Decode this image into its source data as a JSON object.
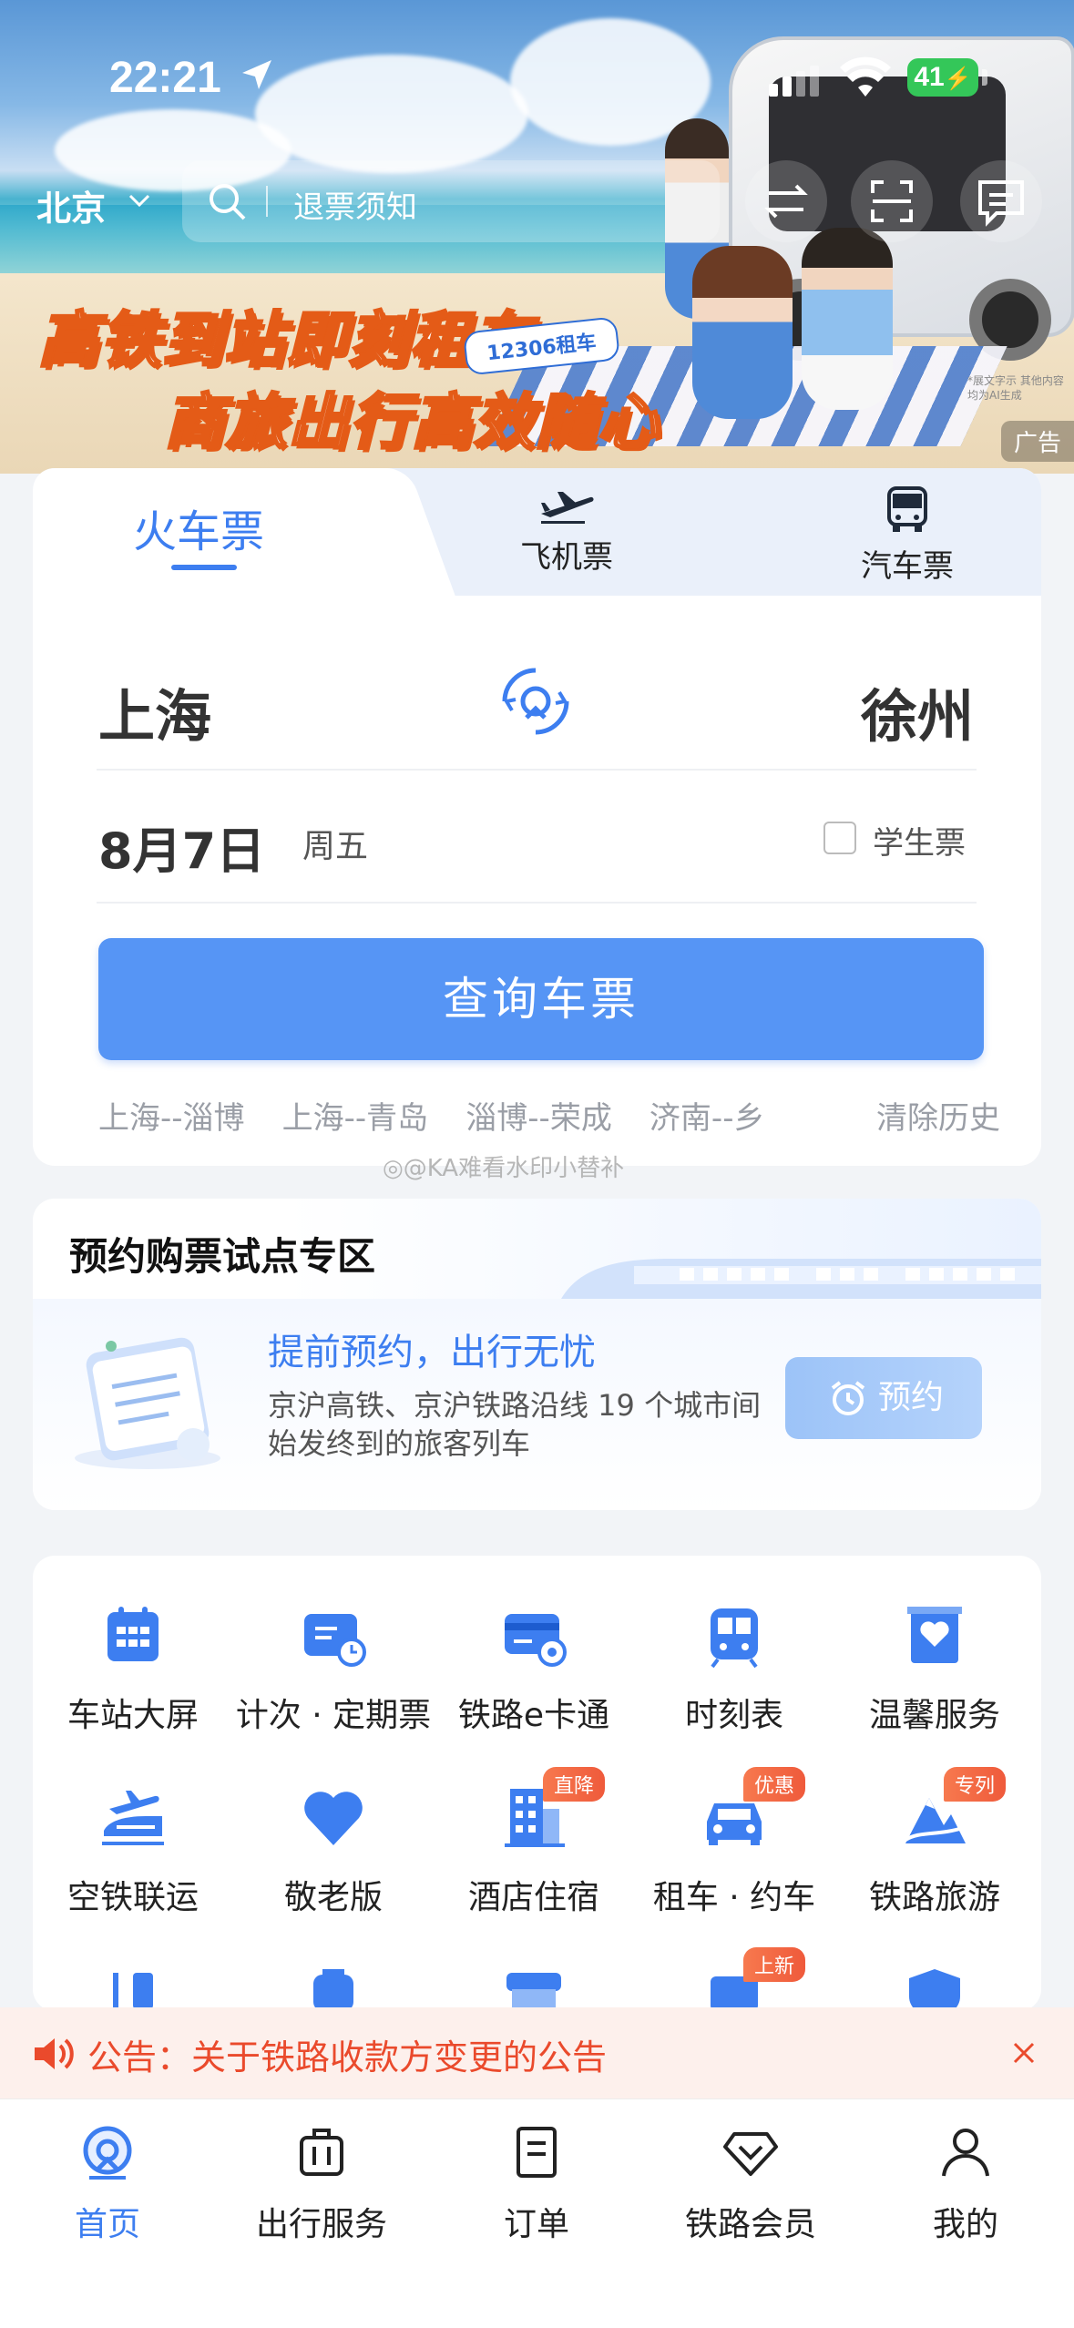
{
  "status_bar": {
    "time": "22:21",
    "battery": "41"
  },
  "hero": {
    "line1": "高铁到站即刻租车",
    "line2": "商旅出行高效随心",
    "tag": "12306租车",
    "note": "*展文字示 其他内容均为AI生成",
    "ad_badge": "广告"
  },
  "top_bar": {
    "city": "北京",
    "search_placeholder": "退票须知"
  },
  "booking": {
    "tabs": [
      {
        "label": "火车票",
        "active": true
      },
      {
        "label": "飞机票",
        "icon": "plane-icon"
      },
      {
        "label": "汽车票",
        "icon": "bus-icon"
      }
    ],
    "from": "上海",
    "to": "徐州",
    "date": "8月7日",
    "weekday": "周五",
    "student_label": "学生票",
    "student_checked": false,
    "query_button": "查询车票",
    "history": [
      "上海--淄博",
      "上海--青岛",
      "淄博--荣成",
      "济南--乡"
    ],
    "clear_history": "清除历史"
  },
  "watermark": "@KA难看水印小替补",
  "reserve": {
    "title": "预约购票试点专区",
    "main": "提前预约，出行无忧",
    "sub": "京沪高铁、京沪铁路沿线 19 个城市间始发终到的旅客列车",
    "button": "预约"
  },
  "services": {
    "items": [
      {
        "label": "车站大屏",
        "icon": "station-screen-icon"
      },
      {
        "label": "计次 · 定期票",
        "icon": "ticket-card-icon"
      },
      {
        "label": "铁路e卡通",
        "icon": "ecard-icon"
      },
      {
        "label": "时刻表",
        "icon": "timetable-icon"
      },
      {
        "label": "温馨服务",
        "icon": "heart-service-icon"
      },
      {
        "label": "空铁联运",
        "icon": "air-rail-icon"
      },
      {
        "label": "敬老版",
        "icon": "heart-icon"
      },
      {
        "label": "酒店住宿",
        "icon": "hotel-icon",
        "badge": "直降"
      },
      {
        "label": "租车 · 约车",
        "icon": "car-icon",
        "badge": "优惠"
      },
      {
        "label": "铁路旅游",
        "icon": "mountain-icon",
        "badge": "专列"
      }
    ],
    "row3_badge": "上新"
  },
  "notice": {
    "text": "公告：关于铁路收款方变更的公告"
  },
  "bottom_nav": [
    {
      "label": "首页",
      "active": true
    },
    {
      "label": "出行服务"
    },
    {
      "label": "订单"
    },
    {
      "label": "铁路会员"
    },
    {
      "label": "我的"
    }
  ],
  "colors": {
    "accent": "#3d7ef0",
    "button": "#5695f5",
    "notice": "#ea4a2c",
    "badge": "#ef5a3b"
  }
}
